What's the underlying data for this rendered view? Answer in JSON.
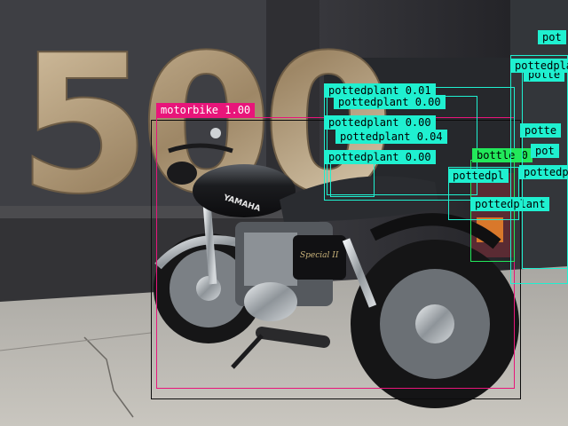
{
  "image": {
    "big_sign_text": "500",
    "bike_tank_brand": "YAMAHA",
    "bike_side_badge": "Special II"
  },
  "detections": [
    {
      "label": "motorbike 1.00",
      "color": "#e8157a"
    },
    {
      "label": "pottedplant 0.01",
      "color": "#1ff0d0"
    },
    {
      "label": "pottedplant 0.00",
      "color": "#1ff0d0"
    },
    {
      "label": "pottedplant 0.00",
      "color": "#1ff0d0"
    },
    {
      "label": "pottedplant 0.04",
      "color": "#1ff0d0"
    },
    {
      "label": "pottedplant 0.00",
      "color": "#1ff0d0"
    },
    {
      "label": "pottedplant 0.00",
      "color": "#1ff0d0"
    },
    {
      "label": "bottle 0",
      "color": "#22e85a"
    },
    {
      "label": "pottedpl",
      "color": "#1ff0d0"
    },
    {
      "label": "pottedplant",
      "color": "#1ff0d0"
    },
    {
      "label": "pottedplant",
      "color": "#1ff0d0"
    },
    {
      "label": "pottedpl",
      "color": "#1ff0d0"
    },
    {
      "label": "potte",
      "color": "#1ff0d0"
    },
    {
      "label": "potte",
      "color": "#1ff0d0"
    },
    {
      "label": "pot",
      "color": "#1ff0d0"
    },
    {
      "label": "pot",
      "color": "#1ff0d0"
    }
  ]
}
